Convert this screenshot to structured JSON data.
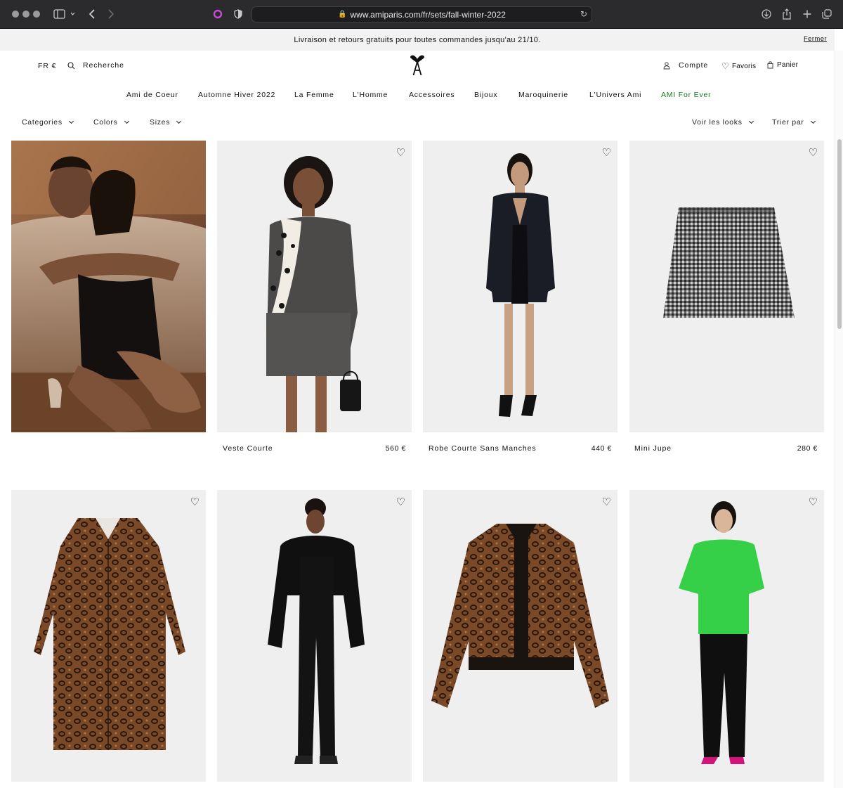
{
  "browser": {
    "url": "www.amiparis.com/fr/sets/fall-winter-2022"
  },
  "announcement": {
    "text": "Livraison et retours gratuits pour toutes commandes jusqu'au 21/10.",
    "close_label": "Fermer"
  },
  "header": {
    "locale": "FR €",
    "search_label": "Recherche",
    "account_label": "Compte",
    "favorites_label": "Favoris",
    "cart_label": "Panier"
  },
  "nav": {
    "items": [
      {
        "label": "Ami de Coeur"
      },
      {
        "label": "Automne Hiver 2022"
      },
      {
        "label": "La Femme"
      },
      {
        "label": "L'Homme"
      },
      {
        "label": "Accessoires"
      },
      {
        "label": "Bijoux"
      },
      {
        "label": "Maroquinerie"
      },
      {
        "label": "L'Univers Ami"
      },
      {
        "label": "AMI For Ever",
        "color": "#157a1f"
      }
    ]
  },
  "filters": {
    "categories": "Categories",
    "colors": "Colors",
    "sizes": "Sizes",
    "looks": "Voir les looks",
    "sort": "Trier par"
  },
  "products": [
    {
      "name": "Veste Courte",
      "price": "560 €"
    },
    {
      "name": "Robe Courte Sans Manches",
      "price": "440 €"
    },
    {
      "name": "Mini Jupe",
      "price": "280 €"
    }
  ],
  "colors": {
    "accent_green": "#157a1f",
    "tile_background": "#efefef"
  }
}
